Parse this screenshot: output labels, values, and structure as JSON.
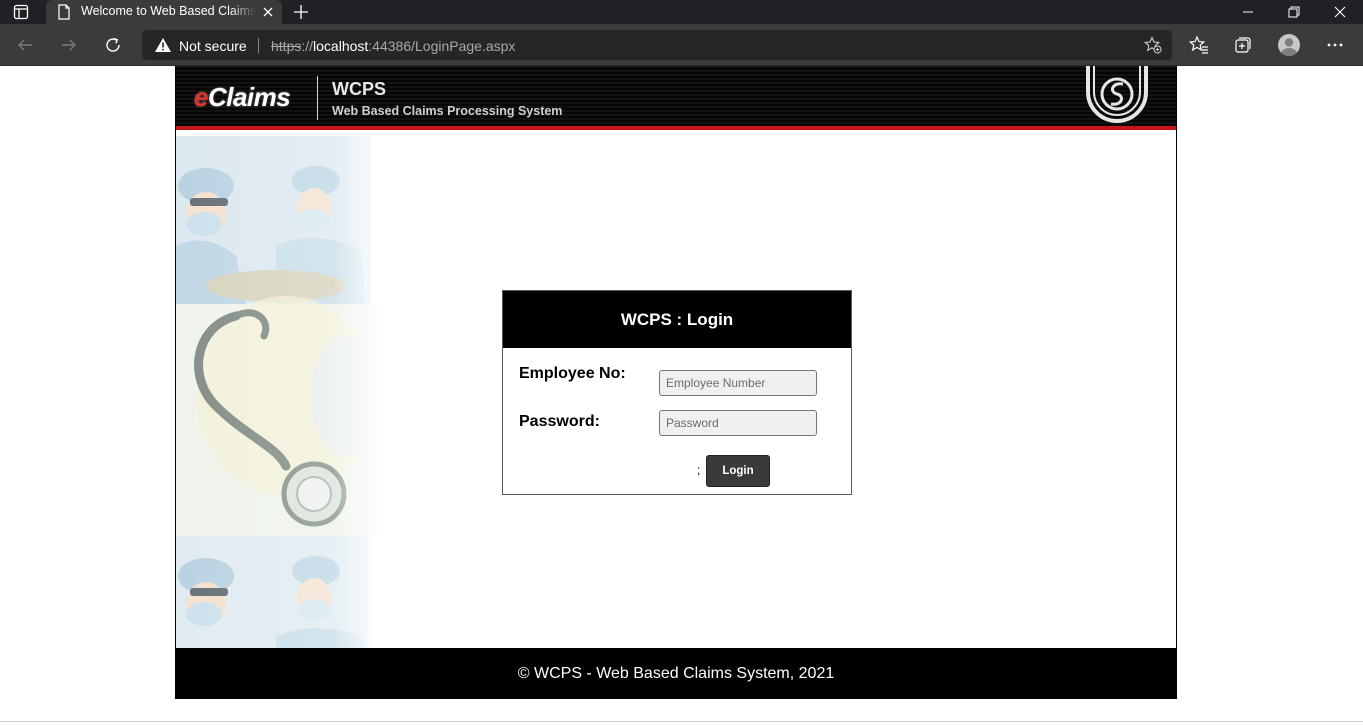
{
  "browser": {
    "tab_title": "Welcome to Web Based Claims Processing System",
    "security_label": "Not secure",
    "url_scheme": "https",
    "url_sep": "://",
    "url_host": "localhost",
    "url_rest": ":44386/LoginPage.aspx",
    "icons": [
      "window-menu-icon",
      "page-icon",
      "close-icon",
      "new-tab-icon",
      "minimize-icon",
      "restore-icon",
      "window-close-icon",
      "back-icon",
      "forward-icon",
      "refresh-icon",
      "warning-icon",
      "add-favorite-icon",
      "favorites-icon",
      "collections-icon",
      "profile-icon",
      "more-icon"
    ]
  },
  "header": {
    "logo_e": "e",
    "logo_rest": "Claims",
    "title": "WCPS",
    "subtitle": "Web Based Claims Processing System"
  },
  "login": {
    "title": "WCPS : Login",
    "employee_label": "Employee No:",
    "employee_placeholder": "Employee Number",
    "employee_value": "",
    "password_label": "Password:",
    "password_placeholder": "Password",
    "password_value": "",
    "stray_text": ";",
    "button_label": "Login"
  },
  "footer": {
    "text": "© WCPS - Web Based Claims System, 2021"
  },
  "colors": {
    "accent_red": "#c8141c",
    "header_bg": "#0b0b0b",
    "button_bg": "#3a3a3a"
  }
}
